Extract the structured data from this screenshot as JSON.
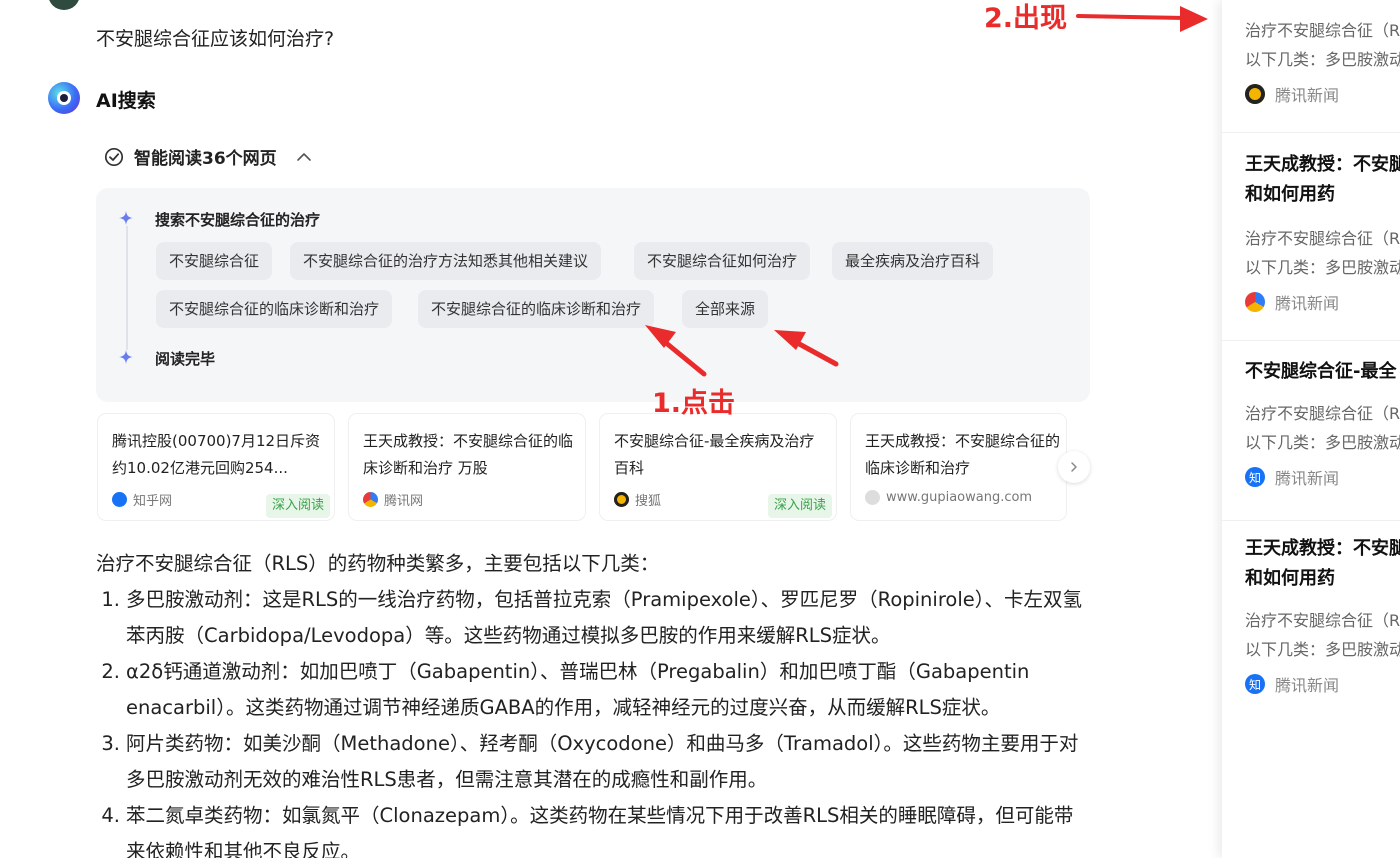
{
  "question": "不安腿综合征应该如何治疗?",
  "ai_title": "AI搜索",
  "reading": {
    "label": "智能阅读36个网页",
    "step1_label": "搜索不安腿综合征的治疗",
    "step2_label": "阅读完毕",
    "chips": [
      "不安腿综合征",
      "不安腿综合征的治疗方法知悉其他相关建议",
      "不安腿综合征如何治疗",
      "最全疾病及治疗百科",
      "不安腿综合征的临床诊断和治疗",
      "不安腿综合征的临床诊断和治疗",
      "全部来源"
    ]
  },
  "sources": [
    {
      "title": "腾讯控股(00700)7月12日斥资约10.02亿港元回购254...",
      "site": "知乎网",
      "badge": "深入阅读",
      "icon": "zhihu-icon"
    },
    {
      "title": "王天成教授：不安腿综合征的临床诊断和治疗 万股",
      "site": "腾讯网",
      "badge": "",
      "icon": "tencent-icon"
    },
    {
      "title": "不安腿综合征-最全疾病及治疗百科",
      "site": "搜狐",
      "badge": "深入阅读",
      "icon": "sohu-icon"
    },
    {
      "title": "王天成教授：不安腿综合征的临床诊断和治疗",
      "site": "www.gupiaowang.com",
      "badge": "",
      "icon": "globe-icon"
    }
  ],
  "answer": {
    "intro": "治疗不安腿综合征（RLS）的药物种类繁多，主要包括以下几类：",
    "items": [
      {
        "num": "1.",
        "text": "多巴胺激动剂：这是RLS的一线治疗药物，包括普拉克索（Pramipexole）、罗匹尼罗（Ropinirole）、卡左双氢苯丙胺（Carbidopa/Levodopa）等。这些药物通过模拟多巴胺的作用来缓解RLS症状。"
      },
      {
        "num": "2.",
        "text": "α2δ钙通道激动剂：如加巴喷丁（Gabapentin）、普瑞巴林（Pregabalin）和加巴喷丁酯（Gabapentin enacarbil）。这类药物通过调节神经递质GABA的作用，减轻神经元的过度兴奋，从而缓解RLS症状。"
      },
      {
        "num": "3.",
        "text": "阿片类药物：如美沙酮（Methadone）、羟考酮（Oxycodone）和曲马多（Tramadol）。这些药物主要用于对多巴胺激动剂无效的难治性RLS患者，但需注意其潜在的成瘾性和副作用。"
      },
      {
        "num": "4.",
        "text": "苯二氮卓类药物：如氯氮平（Clonazepam）。这类药物在某些情况下用于改善RLS相关的睡眠障碍，但可能带来依赖性和其他不良反应。"
      }
    ]
  },
  "annotations": {
    "click_label": "1.点击",
    "appear_label": "2.出现",
    "color": "#ea2b2b"
  },
  "side_panel": {
    "items": [
      {
        "title": "",
        "line1": "治疗不安腿综合征（R",
        "line2": "以下几类：多巴胺激动",
        "source": "腾讯新闻",
        "icon": "sohu-icon"
      },
      {
        "title": "王天成教授：不安腿",
        "title2": "和如何用药",
        "line1": "治疗不安腿综合征（R",
        "line2": "以下几类：多巴胺激动",
        "source": "腾讯新闻",
        "icon": "tencent-icon"
      },
      {
        "title": "不安腿综合征-最全",
        "line1": "治疗不安腿综合征（R",
        "line2": "以下几类：多巴胺激动",
        "source": "腾讯新闻",
        "icon": "zhihu-icon"
      },
      {
        "title": "王天成教授：不安腿",
        "title2": "和如何用药",
        "line1": "治疗不安腿综合征（R",
        "line2": "以下几类：多巴胺激动",
        "source": "腾讯新闻",
        "icon": "zhihu-icon"
      }
    ]
  }
}
